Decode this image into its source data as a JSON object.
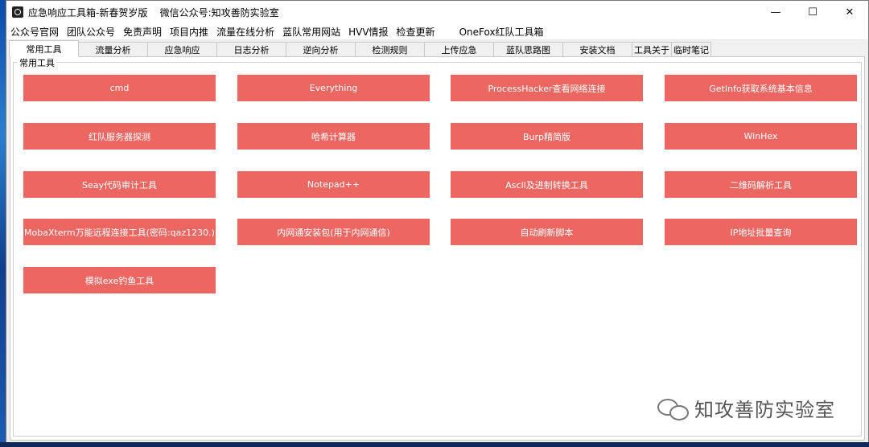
{
  "window": {
    "title": "应急响应工具箱-新春贺岁版    微信公众号:知攻善防实验室",
    "controls": {
      "minimize": "—",
      "maximize": "☐",
      "close": "✕"
    }
  },
  "menu": [
    "公众号官网",
    "团队公众号",
    "免责声明",
    "项目内推",
    "流量在线分析",
    "蓝队常用网站",
    "HVV情报",
    "检查更新",
    "OneFox红队工具箱"
  ],
  "tabs": [
    "常用工具",
    "流量分析",
    "应急响应",
    "日志分析",
    "逆向分析",
    "检测规则",
    "上传应急",
    "蓝队思路图",
    "安装文档",
    "工具关于",
    "临时笔记"
  ],
  "active_tab": "常用工具",
  "group": {
    "label": "常用工具",
    "buttons": [
      "cmd",
      "Everything",
      "ProcessHacker查看网络连接",
      "GetInfo获取系统基本信息",
      "红队服务器探测",
      "哈希计算器",
      "Burp精简版",
      "WinHex",
      "Seay代码审计工具",
      "Notepad++",
      "Ascll及进制转换工具",
      "二维码解析工具",
      "MobaXterm万能远程连接工具(密码:qaz1230.)",
      "内网通安装包(用于内网通信)",
      "自动刷新脚本",
      "IP地址批量查询",
      "模拟exe钓鱼工具"
    ]
  },
  "watermark": "知攻善防实验室",
  "colors": {
    "button_bg": "#ec6762",
    "button_text": "#ffffff",
    "panel_bg": "#ffffff"
  }
}
